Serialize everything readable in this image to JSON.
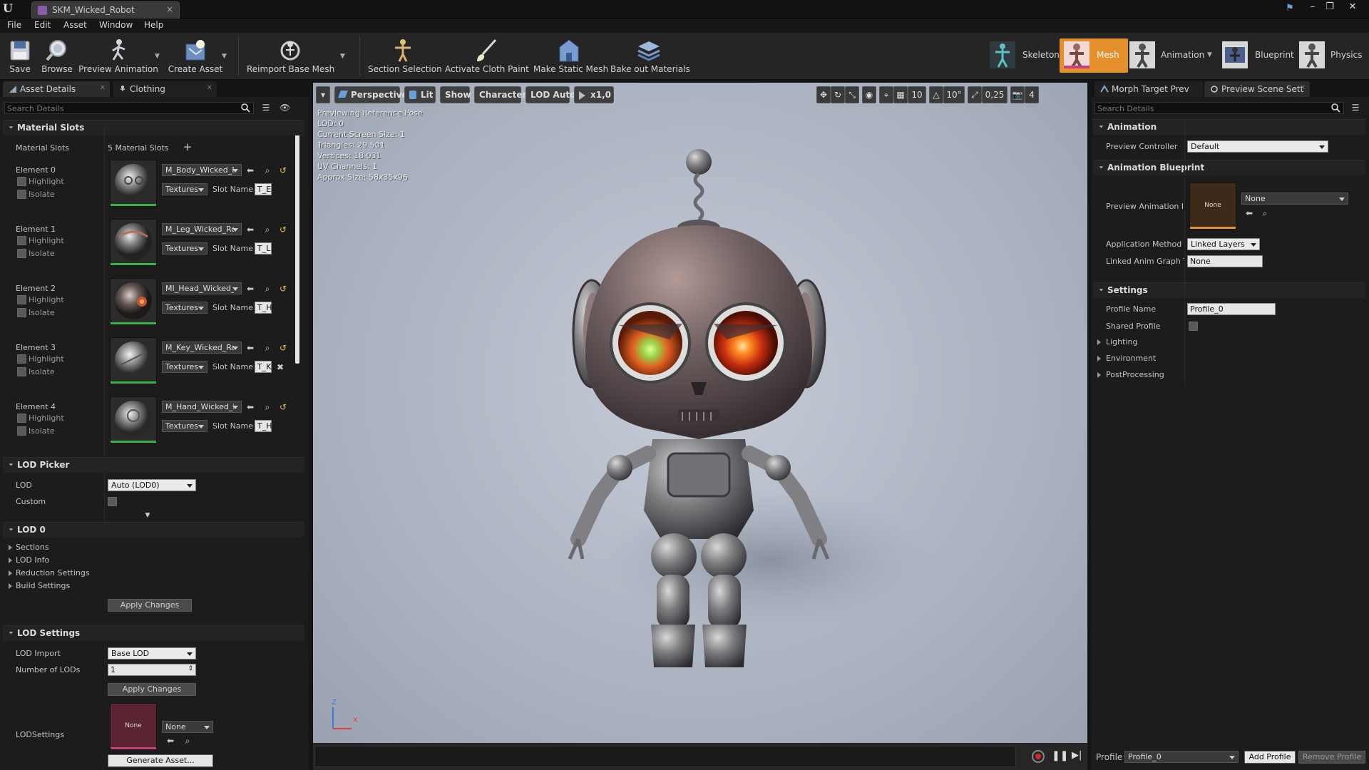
{
  "titlebar": {
    "tab_title": "SKM_Wicked_Robot"
  },
  "menu": [
    "File",
    "Edit",
    "Asset",
    "Window",
    "Help"
  ],
  "toolbar": {
    "buttons": [
      "Save",
      "Browse",
      "Preview Animation",
      "Create Asset",
      "Reimport Base Mesh",
      "Section Selection",
      "Activate Cloth Paint",
      "Make Static Mesh",
      "Bake out Materials"
    ],
    "modes": [
      "Skeleton",
      "Mesh",
      "Animation",
      "Blueprint",
      "Physics"
    ],
    "active_mode": "Mesh",
    "accent_color": "#e3902c"
  },
  "left_panel": {
    "tabs": [
      "Asset Details",
      "Clothing"
    ],
    "search_placeholder": "Search Details",
    "material_slots": {
      "header": "Material Slots",
      "label": "Material Slots",
      "count": "5 Material Slots",
      "elements": [
        {
          "name": "Element 0",
          "material": "M_Body_Wicked_Ro",
          "slot": "T_E"
        },
        {
          "name": "Element 1",
          "material": "M_Leg_Wicked_Rob",
          "slot": "T_L"
        },
        {
          "name": "Element 2",
          "material": "MI_Head_Wicked_R",
          "slot": "T_H"
        },
        {
          "name": "Element 3",
          "material": "M_Key_Wicked_Rot",
          "slot": "T_K"
        },
        {
          "name": "Element 4",
          "material": "M_Hand_Wicked_Ro",
          "slot": "T_H"
        }
      ],
      "highlight_label": "Highlight",
      "isolate_label": "Isolate",
      "textures_label": "Textures",
      "slot_name_label": "Slot Name"
    },
    "lod_picker": {
      "header": "LOD Picker",
      "lod_label": "LOD",
      "lod_value": "Auto (LOD0)",
      "custom_label": "Custom"
    },
    "lod0": {
      "header": "LOD 0",
      "items": [
        "Sections",
        "LOD Info",
        "Reduction Settings",
        "Build Settings"
      ],
      "apply": "Apply Changes"
    },
    "lod_settings": {
      "header": "LOD Settings",
      "import_label": "LOD Import",
      "import_value": "Base LOD",
      "num_label": "Number of LODs",
      "num_value": "1",
      "apply": "Apply Changes",
      "lodsettings_label": "LODSettings",
      "asset_thumb_text": "None",
      "asset_value": "None",
      "generate": "Generate Asset..."
    }
  },
  "viewport": {
    "toolbar": {
      "perspective": "Perspective",
      "lit": "Lit",
      "show": "Show",
      "character": "Character",
      "lod": "LOD Auto",
      "speed": "x1,0",
      "grid": "10",
      "angle": "10°",
      "scale": "0,25",
      "cam": "4"
    },
    "stats": [
      "Previewing Reference Pose",
      "LOD: 0",
      "Current Screen Size: 1",
      "Triangles: 29 501",
      "Vertices: 18 031",
      "UV Channels: 1",
      "Approx Size: 58x35x96"
    ],
    "axis_x": "X",
    "axis_z": "Z"
  },
  "right_panel": {
    "tabs": [
      "Morph Target Prev",
      "Preview Scene Sett"
    ],
    "search_placeholder": "Search Details",
    "animation": {
      "header": "Animation",
      "controller_label": "Preview Controller",
      "controller_value": "Default"
    },
    "anim_bp": {
      "header": "Animation Blueprint",
      "preview_label": "Preview Animation Blu",
      "thumb_text": "None",
      "asset_value": "None",
      "method_label": "Application Method",
      "method_value": "Linked Layers",
      "linked_label": "Linked Anim Graph Ta",
      "linked_value": "None"
    },
    "settings": {
      "header": "Settings",
      "profile_label": "Profile Name",
      "profile_value": "Profile_0",
      "shared_label": "Shared Profile",
      "sub": [
        "Lighting",
        "Environment",
        "PostProcessing"
      ]
    },
    "footer": {
      "profile_label": "Profile",
      "profile_value": "Profile_0",
      "add": "Add Profile",
      "remove": "Remove Profile"
    }
  }
}
